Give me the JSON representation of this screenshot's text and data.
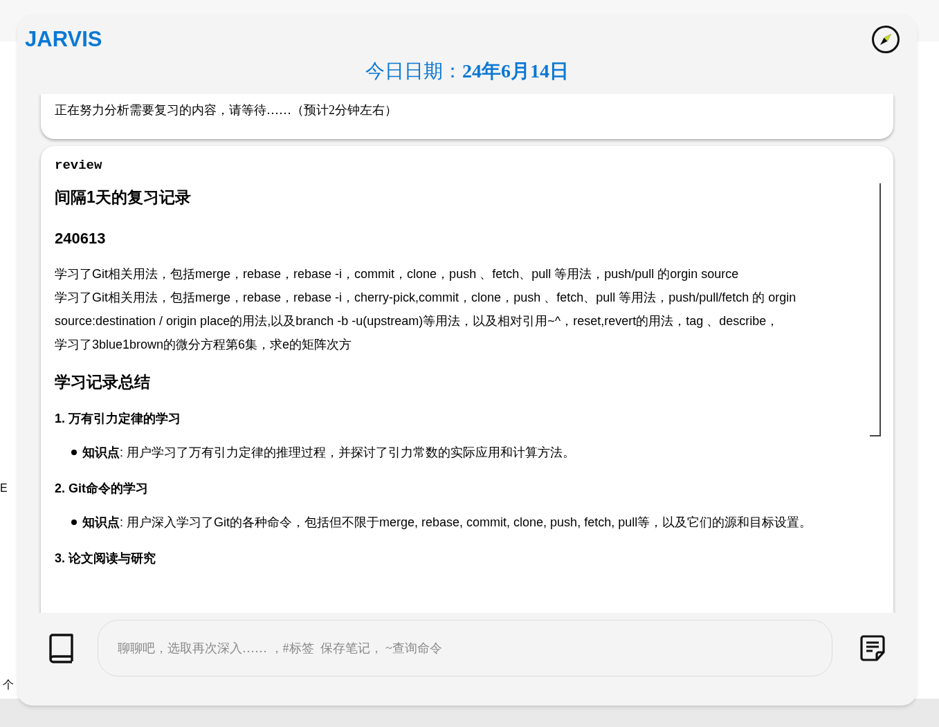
{
  "background_fragments": [
    "E",
    "个"
  ],
  "app": {
    "title": "JARVIS"
  },
  "date_heading": "今日日期：**24年6月14日**",
  "status_card": {
    "text": "正在努力分析需要复习的内容，请等待……（预计2分钟左右）"
  },
  "review_card": {
    "tag": "review",
    "heading": "间隔1天的复习记录",
    "date": "240613",
    "records": [
      "学习了Git相关用法，包括merge，rebase，rebase -i，commit，clone，push 、fetch、pull 等用法，push/pull 的orgin source",
      "学习了Git相关用法，包括merge，rebase，rebase -i，cherry-pick,commit，clone，push 、fetch、pull 等用法，push/pull/fetch 的 orgin source:destination / origin place的用法,以及branch -b -u(upstream)等用法，以及相对引用~^，reset,revert的用法，tag 、describe，",
      "学习了3blue1brown的微分方程第6集，求e的矩阵次方"
    ],
    "summary_heading": "学习记录总结",
    "sections": [
      {
        "title": "1. 万有引力定律的学习",
        "bullets": [
          "**知识点**: 用户学习了万有引力定律的推理过程，并探讨了引力常数的实际应用和计算方法。"
        ]
      },
      {
        "title": "2. Git命令的学习",
        "bullets": [
          "**知识点**: 用户深入学习了Git的各种命令，包括但不限于merge, rebase, commit, clone, push, fetch, pull等，以及它们的源和目标设置。"
        ]
      },
      {
        "title": "3. 论文阅读与研究"
      }
    ]
  },
  "input": {
    "placeholder": "聊聊吧，选取再次深入…… ，#标签  保存笔记， ~查询命令"
  }
}
